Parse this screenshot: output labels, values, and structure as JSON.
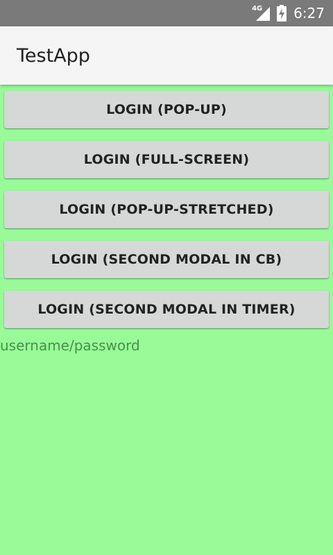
{
  "status_bar": {
    "network_type": "4G",
    "time": "6:27",
    "icons": [
      "signal-icon",
      "battery-charging-icon"
    ]
  },
  "app_bar": {
    "title": "TestApp"
  },
  "buttons": [
    {
      "label": "LOGIN (POP-UP)"
    },
    {
      "label": "LOGIN (FULL-SCREEN)"
    },
    {
      "label": "LOGIN (POP-UP-STRETCHED)"
    },
    {
      "label": "LOGIN (SECOND MODAL IN CB)"
    },
    {
      "label": "LOGIN (SECOND MODAL IN TIMER)"
    }
  ],
  "hint": {
    "text": "username/password"
  },
  "colors": {
    "background": "#98fb98",
    "status_bar": "#7a7a7a",
    "app_bar": "#f5f5f5",
    "button": "#d6d7d7",
    "hint_text": "#4a8f4a"
  }
}
